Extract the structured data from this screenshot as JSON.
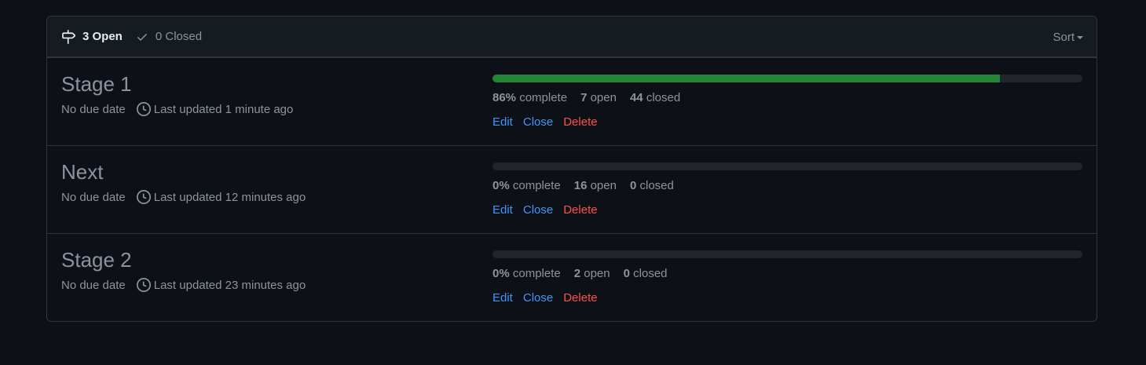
{
  "header": {
    "open_label": "3 Open",
    "closed_label": "0 Closed",
    "sort_label": "Sort"
  },
  "milestones": [
    {
      "title": "Stage 1",
      "due": "No due date",
      "updated": "Last updated 1 minute ago",
      "percent": "86%",
      "percent_value": 86,
      "complete_label": "complete",
      "open_count": "7",
      "open_label": "open",
      "closed_count": "44",
      "closed_label": "closed"
    },
    {
      "title": "Next",
      "due": "No due date",
      "updated": "Last updated 12 minutes ago",
      "percent": "0%",
      "percent_value": 0,
      "complete_label": "complete",
      "open_count": "16",
      "open_label": "open",
      "closed_count": "0",
      "closed_label": "closed"
    },
    {
      "title": "Stage 2",
      "due": "No due date",
      "updated": "Last updated 23 minutes ago",
      "percent": "0%",
      "percent_value": 0,
      "complete_label": "complete",
      "open_count": "2",
      "open_label": "open",
      "closed_count": "0",
      "closed_label": "closed"
    }
  ],
  "actions": {
    "edit": "Edit",
    "close": "Close",
    "delete": "Delete"
  },
  "icons": {
    "open": "milestone-icon",
    "closed": "check-icon",
    "updated": "clock-icon"
  },
  "colors": {
    "progress": "#238636",
    "link": "#4493f8",
    "danger": "#f85149"
  }
}
